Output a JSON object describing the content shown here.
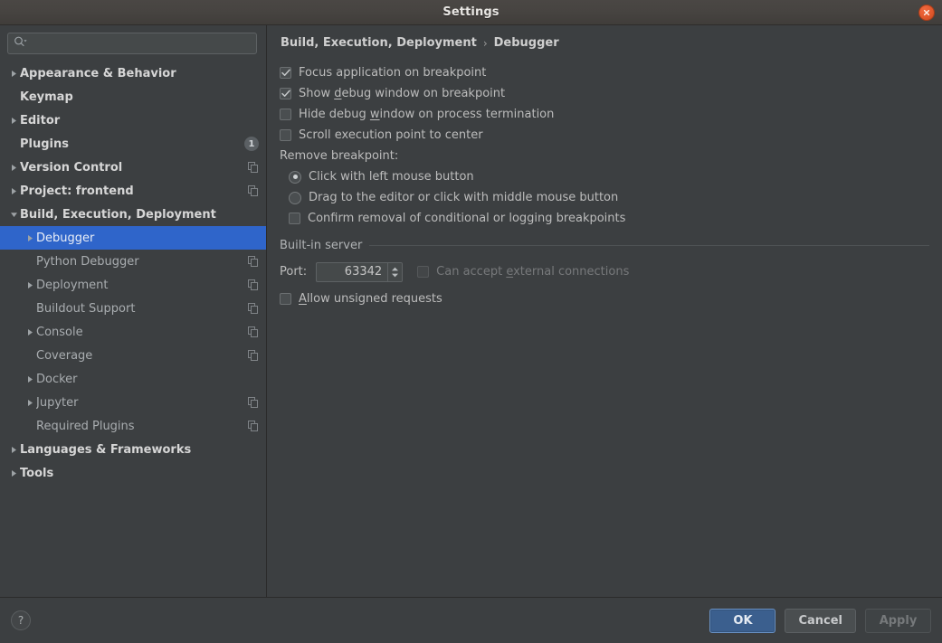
{
  "window": {
    "title": "Settings",
    "close_icon": "close-icon"
  },
  "search": {
    "placeholder": "",
    "value": "",
    "icon": "search-icon"
  },
  "sidebar": {
    "items": [
      {
        "label": "Appearance & Behavior",
        "level": 0,
        "arrow": "collapsed",
        "selected": false,
        "badge": "",
        "copy": false
      },
      {
        "label": "Keymap",
        "level": 0,
        "arrow": "none",
        "selected": false,
        "badge": "",
        "copy": false
      },
      {
        "label": "Editor",
        "level": 0,
        "arrow": "collapsed",
        "selected": false,
        "badge": "",
        "copy": false
      },
      {
        "label": "Plugins",
        "level": 0,
        "arrow": "none",
        "selected": false,
        "badge": "1",
        "copy": false
      },
      {
        "label": "Version Control",
        "level": 0,
        "arrow": "collapsed",
        "selected": false,
        "badge": "",
        "copy": true
      },
      {
        "label": "Project: frontend",
        "level": 0,
        "arrow": "collapsed",
        "selected": false,
        "badge": "",
        "copy": true
      },
      {
        "label": "Build, Execution, Deployment",
        "level": 0,
        "arrow": "expanded",
        "selected": false,
        "badge": "",
        "copy": false
      },
      {
        "label": "Debugger",
        "level": 1,
        "arrow": "collapsed",
        "selected": true,
        "badge": "",
        "copy": false
      },
      {
        "label": "Python Debugger",
        "level": 1,
        "arrow": "none",
        "selected": false,
        "badge": "",
        "copy": true
      },
      {
        "label": "Deployment",
        "level": 1,
        "arrow": "collapsed",
        "selected": false,
        "badge": "",
        "copy": true
      },
      {
        "label": "Buildout Support",
        "level": 1,
        "arrow": "none",
        "selected": false,
        "badge": "",
        "copy": true
      },
      {
        "label": "Console",
        "level": 1,
        "arrow": "collapsed",
        "selected": false,
        "badge": "",
        "copy": true
      },
      {
        "label": "Coverage",
        "level": 1,
        "arrow": "none",
        "selected": false,
        "badge": "",
        "copy": true
      },
      {
        "label": "Docker",
        "level": 1,
        "arrow": "collapsed",
        "selected": false,
        "badge": "",
        "copy": false
      },
      {
        "label": "Jupyter",
        "level": 1,
        "arrow": "collapsed",
        "selected": false,
        "badge": "",
        "copy": true
      },
      {
        "label": "Required Plugins",
        "level": 1,
        "arrow": "none",
        "selected": false,
        "badge": "",
        "copy": true
      },
      {
        "label": "Languages & Frameworks",
        "level": 0,
        "arrow": "collapsed",
        "selected": false,
        "badge": "",
        "copy": false
      },
      {
        "label": "Tools",
        "level": 0,
        "arrow": "collapsed",
        "selected": false,
        "badge": "",
        "copy": false
      }
    ]
  },
  "breadcrumb": {
    "parent": "Build, Execution, Deployment",
    "separator": "›",
    "current": "Debugger"
  },
  "options": {
    "checkboxes": [
      {
        "label_pre": "Focus application on breakpoint",
        "mnemonic": "",
        "label_post": "",
        "checked": true,
        "enabled": true
      },
      {
        "label_pre": "Show ",
        "mnemonic": "d",
        "label_post": "ebug window on breakpoint",
        "checked": true,
        "enabled": true
      },
      {
        "label_pre": "Hide debug ",
        "mnemonic": "w",
        "label_post": "indow on process termination",
        "checked": false,
        "enabled": true
      },
      {
        "label_pre": "Scroll execution point to center",
        "mnemonic": "",
        "label_post": "",
        "checked": false,
        "enabled": true
      }
    ],
    "remove_breakpoint_label": "Remove breakpoint:",
    "radios": [
      {
        "label": "Click with left mouse button",
        "selected": true
      },
      {
        "label": "Drag to the editor or click with middle mouse button",
        "selected": false
      }
    ],
    "confirm_removal": {
      "label": "Confirm removal of conditional or logging breakpoints",
      "checked": false,
      "enabled": true
    }
  },
  "builtin_server": {
    "group_title": "Built-in server",
    "port_label": "Port:",
    "port_value": "63342",
    "external": {
      "label_pre": "Can accept ",
      "mnemonic": "e",
      "label_post": "xternal connections",
      "checked": false,
      "enabled": false
    },
    "unsigned": {
      "label_pre": "",
      "mnemonic": "A",
      "label_post": "llow unsigned requests",
      "checked": false,
      "enabled": true
    }
  },
  "footer": {
    "help_label": "?",
    "ok_label": "OK",
    "cancel_label": "Cancel",
    "apply_label": "Apply"
  },
  "colors": {
    "background": "#3c3f41",
    "selection": "#2f65ca",
    "primary_button": "#3b5f8e",
    "close_button": "#e2582c"
  }
}
